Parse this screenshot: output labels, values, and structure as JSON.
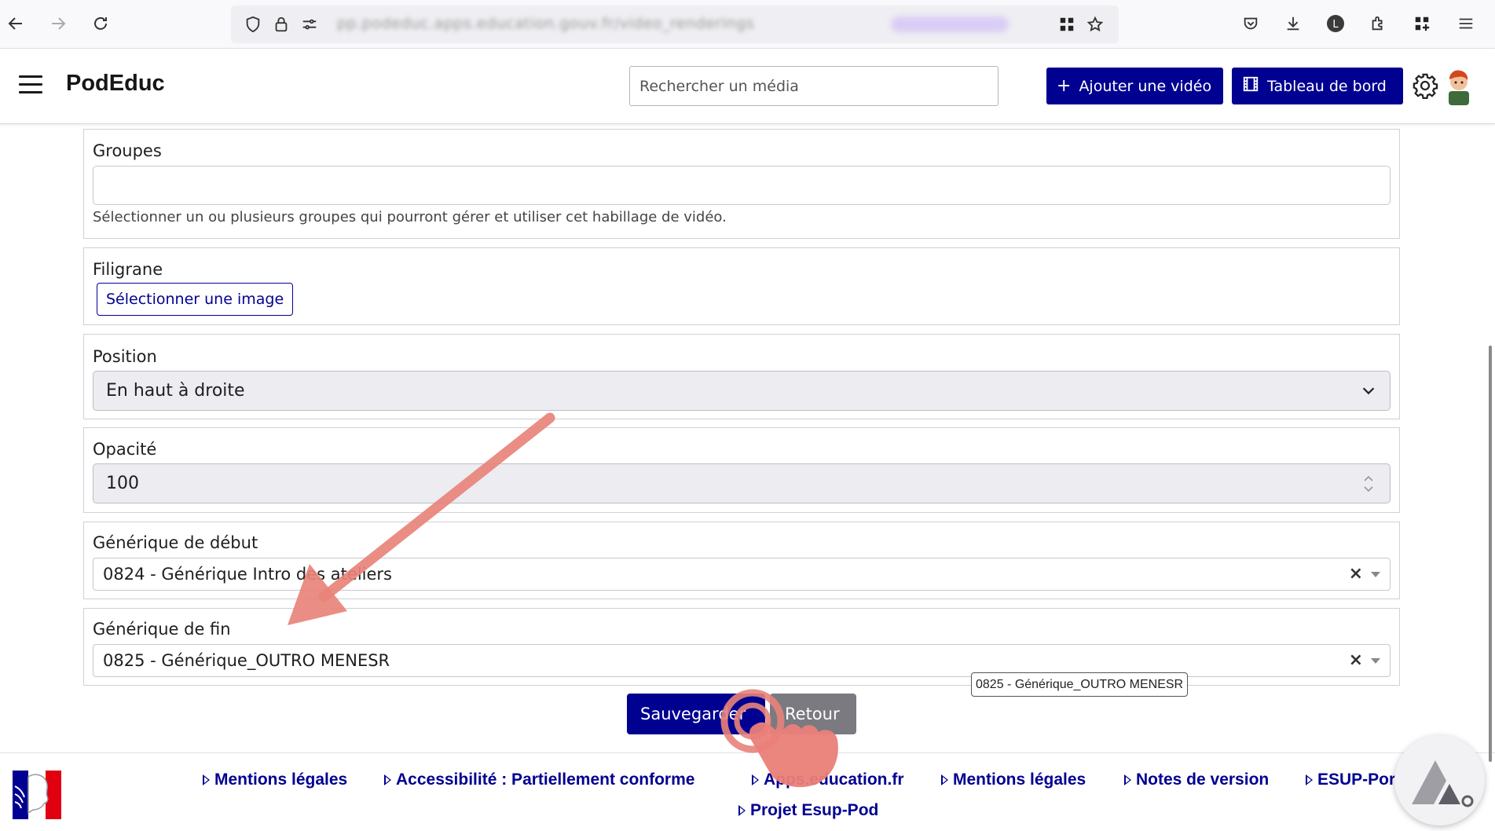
{
  "browser": {
    "url_blurred": "pp.podeduc.apps.education.gouv.fr/video_renderings",
    "icons": [
      "back-arrow-icon",
      "forward-arrow-icon",
      "reload-icon",
      "shield-icon",
      "lock-icon",
      "permissions-icon",
      "extensions-grid-icon",
      "star-icon",
      "pocket-icon",
      "download-icon",
      "profile-icon",
      "puzzle-icon",
      "apps-icon",
      "menu-icon"
    ]
  },
  "header": {
    "brand": "PodEduc",
    "search_placeholder": "Rechercher un média",
    "add_video_label": "Ajouter une vidéo",
    "dashboard_label": "Tableau de bord"
  },
  "form": {
    "groups": {
      "label": "Groupes",
      "value": "",
      "help": "Sélectionner un ou plusieurs groupes qui pourront gérer et utiliser cet habillage de vidéo."
    },
    "watermark": {
      "label": "Filigrane",
      "button": "Sélectionner une image"
    },
    "position": {
      "label": "Position",
      "value": "En haut à droite"
    },
    "opacity": {
      "label": "Opacité",
      "value": "100"
    },
    "intro": {
      "label": "Générique de début",
      "value": "0824 - Générique Intro des ateliers"
    },
    "outro": {
      "label": "Générique de fin",
      "value": "0825 - Générique_OUTRO MENESR",
      "tooltip": "0825 - Générique_OUTRO MENESR"
    },
    "save_label": "Sauvegarder",
    "back_label": "Retour"
  },
  "footer": {
    "links_row1": [
      "Mentions légales",
      "Accessibilité : Partiellement conforme",
      "Apps.education.fr",
      "Mentions légales",
      "Notes de version",
      "ESUP-Portail"
    ],
    "links_row2": [
      "Projet Esup-Pod"
    ]
  },
  "colors": {
    "primary": "#000091",
    "secondary": "#7a7a80",
    "annotation_arrow": "#e8837a",
    "border": "#d0d0d6"
  }
}
